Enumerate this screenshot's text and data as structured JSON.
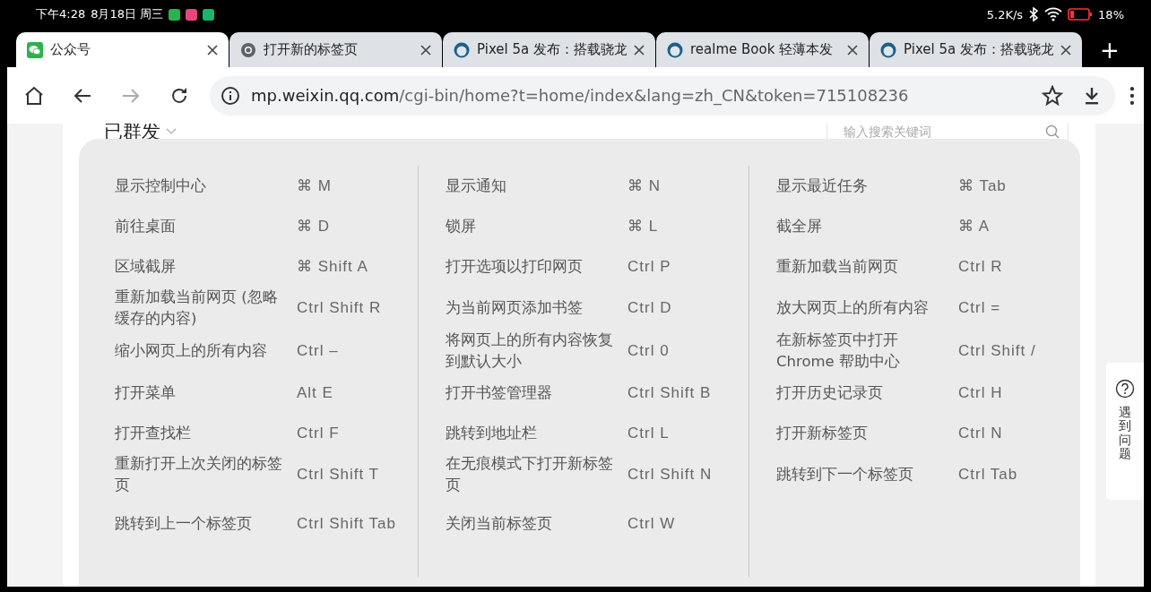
{
  "status_bar": {
    "time": "下午4:28",
    "date": "8月18日 周三",
    "apps": [
      {
        "color": "#2bb24c"
      },
      {
        "color": "#e8467c"
      },
      {
        "color": "#19b56a"
      }
    ],
    "speed": "5.2K/s",
    "battery": "18%"
  },
  "tabs": [
    {
      "title": "公众号",
      "kind": "chat",
      "selected": true
    },
    {
      "title": "打开新的标签页",
      "kind": "browser",
      "selected": false
    },
    {
      "title": "Pixel 5a 发布：搭载骁龙",
      "kind": "site",
      "selected": false
    },
    {
      "title": "realme Book 轻薄本发",
      "kind": "site",
      "selected": false
    },
    {
      "title": "Pixel 5a 发布：搭载骁龙",
      "kind": "site",
      "selected": false
    }
  ],
  "new_tab": "+",
  "address_bar": {
    "domain": "mp.weixin.qq.com",
    "path": "/cgi-bin/home?t=home/index&lang=zh_CN&token=715108236"
  },
  "page": {
    "heading": "已群发",
    "search": {
      "placeholder": "输入搜索关键词"
    }
  },
  "shortcut_rows": [
    [
      {
        "action": "显示控制中心",
        "keys": "⌘ M"
      },
      {
        "action": "显示通知",
        "keys": "⌘ N"
      },
      {
        "action": "显示最近任务",
        "keys": "⌘ Tab"
      }
    ],
    [
      {
        "action": "前往桌面",
        "keys": "⌘ D"
      },
      {
        "action": "锁屏",
        "keys": "⌘ L"
      },
      {
        "action": "截全屏",
        "keys": "⌘ A"
      }
    ],
    [
      {
        "action": "区域截屏",
        "keys": "⌘ Shift A"
      },
      {
        "action": "打开选项以打印网页",
        "keys": "Ctrl P"
      },
      {
        "action": "重新加载当前网页",
        "keys": "Ctrl R"
      }
    ],
    [
      {
        "action": "重新加载当前网页 (忽略缓存的内容)",
        "keys": "Ctrl Shift R"
      },
      {
        "action": "为当前网页添加书签",
        "keys": "Ctrl D"
      },
      {
        "action": "放大网页上的所有内容",
        "keys": "Ctrl ="
      }
    ],
    [
      {
        "action": "缩小网页上的所有内容",
        "keys": "Ctrl –"
      },
      {
        "action": "将网页上的所有内容恢复到默认大小",
        "keys": "Ctrl 0"
      },
      {
        "action": "在新标签页中打开 Chrome 帮助中心",
        "keys": "Ctrl Shift /"
      }
    ],
    [
      {
        "action": "打开菜单",
        "keys": "Alt E"
      },
      {
        "action": "打开书签管理器",
        "keys": "Ctrl Shift B"
      },
      {
        "action": "打开历史记录页",
        "keys": "Ctrl H"
      }
    ],
    [
      {
        "action": "打开查找栏",
        "keys": "Ctrl F"
      },
      {
        "action": "跳转到地址栏",
        "keys": "Ctrl L"
      },
      {
        "action": "打开新标签页",
        "keys": "Ctrl N"
      }
    ],
    [
      {
        "action": "重新打开上次关闭的标签页",
        "keys": "Ctrl Shift T"
      },
      {
        "action": "在无痕模式下打开新标签页",
        "keys": "Ctrl Shift N"
      },
      {
        "action": "跳转到下一个标签页",
        "keys": "Ctrl Tab"
      }
    ],
    [
      {
        "action": "跳转到上一个标签页",
        "keys": "Ctrl Shift Tab"
      },
      {
        "action": "关闭当前标签页",
        "keys": "Ctrl W"
      },
      null
    ]
  ],
  "help_widget": {
    "label": "遇到问题"
  }
}
